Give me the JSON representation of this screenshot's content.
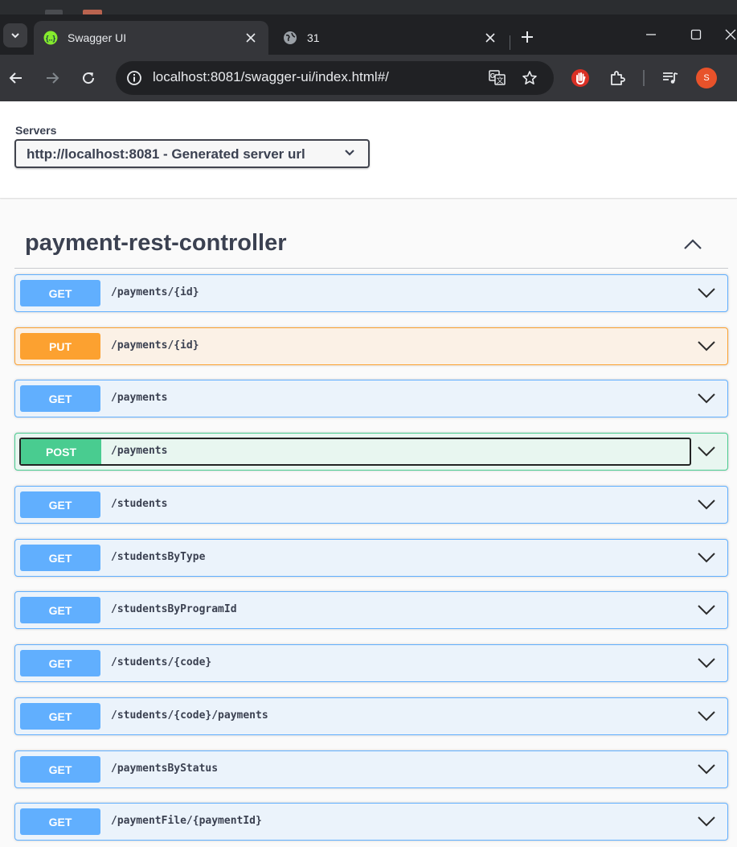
{
  "browser": {
    "tabs": [
      {
        "title": "Swagger UI",
        "active": true,
        "favicon": "swagger-icon"
      },
      {
        "title": "31",
        "active": false,
        "favicon": "globe-icon"
      }
    ],
    "url": "localhost:8081/swagger-ui/index.html#/",
    "profile_initial": "S",
    "colors": {
      "frame": "#202124",
      "toolbar": "#35363a",
      "profile": "#e8522a"
    }
  },
  "servers": {
    "label": "Servers",
    "selected": "http://localhost:8081 - Generated server url"
  },
  "tag": {
    "name": "payment-rest-controller",
    "expanded": true
  },
  "operations": [
    {
      "method": "GET",
      "path": "/payments/{id}"
    },
    {
      "method": "PUT",
      "path": "/payments/{id}"
    },
    {
      "method": "GET",
      "path": "/payments"
    },
    {
      "method": "POST",
      "path": "/payments"
    },
    {
      "method": "GET",
      "path": "/students"
    },
    {
      "method": "GET",
      "path": "/studentsByType"
    },
    {
      "method": "GET",
      "path": "/studentsByProgramId"
    },
    {
      "method": "GET",
      "path": "/students/{code}"
    },
    {
      "method": "GET",
      "path": "/students/{code}/payments"
    },
    {
      "method": "GET",
      "path": "/paymentsByStatus"
    },
    {
      "method": "GET",
      "path": "/paymentFile/{paymentId}"
    }
  ],
  "method_colors": {
    "GET": "#61affe",
    "PUT": "#fca130",
    "POST": "#49cc90"
  }
}
